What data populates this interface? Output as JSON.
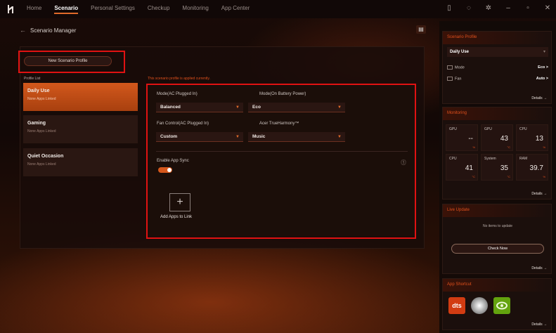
{
  "nav": {
    "tabs": [
      "Home",
      "Scenario",
      "Personal Settings",
      "Checkup",
      "Monitoring",
      "App Center"
    ],
    "active": "Scenario"
  },
  "header": {
    "title": "Scenario Manager"
  },
  "main": {
    "new_profile_label": "New Scenario Profile",
    "profile_list_label": "Profile List",
    "notice": "This scenario profile is applied currently.",
    "profiles": [
      {
        "name": "Daily Use",
        "sub": "None Apps Linked"
      },
      {
        "name": "Gaming",
        "sub": "None Apps Linked"
      },
      {
        "name": "Quiet Occasion",
        "sub": "None Apps Linked"
      }
    ],
    "settings": {
      "mode_ac_label": "Mode(AC Plugged In)",
      "mode_ac_value": "Balanced",
      "mode_batt_label": "Mode(On Battery Power)",
      "mode_batt_value": "Eco",
      "fan_label": "Fan Control(AC Plugged In)",
      "fan_value": "Custom",
      "audio_label": "Acer TrueHarmony™",
      "audio_value": "Music",
      "sync_label": "Enable App Sync",
      "add_apps_label": "Add Apps to Link"
    }
  },
  "sidebar": {
    "scenario_profile": {
      "title": "Scenario Profile",
      "selected": "Daily Use",
      "mode_label": "Mode",
      "mode_value": "Eco >",
      "fan_label": "Fan",
      "fan_value": "Auto >",
      "details": "Details →"
    },
    "monitoring": {
      "title": "Monitoring",
      "cells": [
        {
          "label": "GPU",
          "value": "--",
          "unit": "%"
        },
        {
          "label": "GPU",
          "value": "43",
          "unit": "°C"
        },
        {
          "label": "CPU",
          "value": "13",
          "unit": "%"
        },
        {
          "label": "CPU",
          "value": "41",
          "unit": "°C"
        },
        {
          "label": "System",
          "value": "35",
          "unit": "°C"
        },
        {
          "label": "RAM",
          "value": "39.7",
          "unit": "%"
        }
      ],
      "details": "Details →"
    },
    "live_update": {
      "title": "Live Update",
      "message": "No items to update",
      "check_label": "Check Now",
      "details": "Details →"
    },
    "app_shortcut": {
      "title": "App Shortcut",
      "apps": [
        "dts",
        "disc",
        "nvidia"
      ],
      "details": "Details →"
    }
  },
  "colors": {
    "accent": "#d5571c",
    "highlight": "#e01212"
  }
}
